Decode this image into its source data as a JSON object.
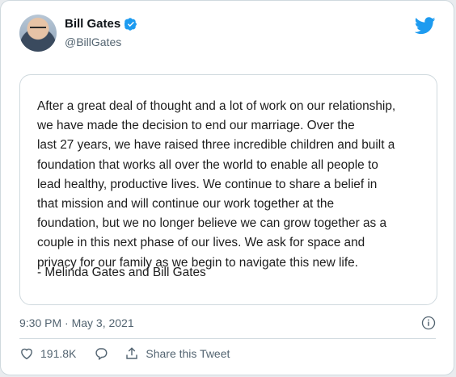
{
  "tweet": {
    "author_name": "Bill Gates",
    "author_handle": "@BillGates",
    "verified_icon": "verified-badge-icon",
    "platform_icon": "twitter-bird-icon",
    "statement_text": "After a great deal of thought and a lot of work on our relationship,\nwe have made the decision to end our marriage. Over the\nlast 27 years, we have raised three incredible children and built a\nfoundation that works all over the world to enable all people to\nlead healthy, productive lives. We continue to share a belief in\nthat mission and will continue our work together at the\nfoundation, but we no longer believe we can grow together as a\ncouple in this next phase of our lives. We ask for space and\nprivacy for our family as we begin to navigate this new life.",
    "signature": "- Melinda Gates and Bill Gates",
    "timestamp": "9:30 PM · May 3, 2021",
    "likes_count": "191.8K",
    "share_label": "Share this Tweet"
  },
  "colors": {
    "accent": "#1d9bf0",
    "text_primary": "#0f1419",
    "text_secondary": "#536471",
    "border": "#cfd9de"
  }
}
